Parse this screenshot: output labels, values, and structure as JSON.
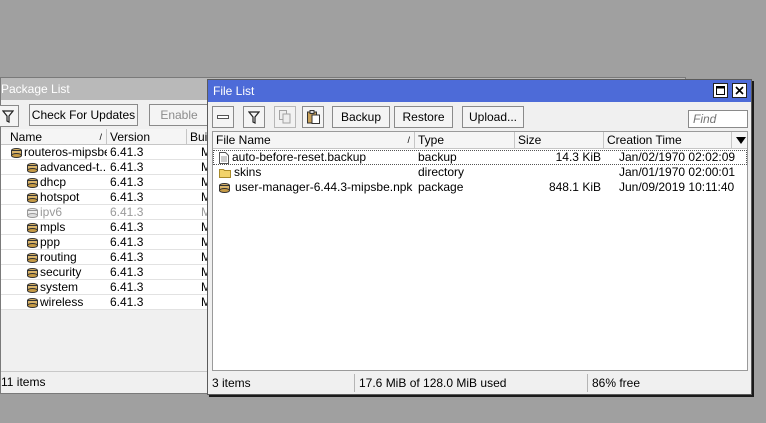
{
  "package_window": {
    "title": "Package List",
    "toolbar": {
      "check_updates": "Check For Updates",
      "enable": "Enable"
    },
    "columns": [
      "Name",
      "Version",
      "Build"
    ],
    "rows": [
      {
        "name": "routeros-mipsbe",
        "version": "6.41.3",
        "build": "M",
        "muted": false
      },
      {
        "name": "advanced-t...",
        "version": "6.41.3",
        "build": "M",
        "muted": false
      },
      {
        "name": "dhcp",
        "version": "6.41.3",
        "build": "M",
        "muted": false
      },
      {
        "name": "hotspot",
        "version": "6.41.3",
        "build": "M",
        "muted": false
      },
      {
        "name": "ipv6",
        "version": "6.41.3",
        "build": "M",
        "muted": true
      },
      {
        "name": "mpls",
        "version": "6.41.3",
        "build": "M",
        "muted": false
      },
      {
        "name": "ppp",
        "version": "6.41.3",
        "build": "M",
        "muted": false
      },
      {
        "name": "routing",
        "version": "6.41.3",
        "build": "M",
        "muted": false
      },
      {
        "name": "security",
        "version": "6.41.3",
        "build": "M",
        "muted": false
      },
      {
        "name": "system",
        "version": "6.41.3",
        "build": "M",
        "muted": false
      },
      {
        "name": "wireless",
        "version": "6.41.3",
        "build": "M",
        "muted": false
      }
    ],
    "status": "11 items"
  },
  "file_window": {
    "title": "File List",
    "toolbar": {
      "backup": "Backup",
      "restore": "Restore",
      "upload": "Upload...",
      "find_placeholder": "Find"
    },
    "columns": {
      "name": "File Name",
      "type": "Type",
      "size": "Size",
      "created": "Creation Time"
    },
    "rows": [
      {
        "name": "auto-before-reset.backup",
        "type": "backup",
        "size": "14.3 KiB",
        "created": "Jan/02/1970 02:02:09",
        "icon": "file-icon"
      },
      {
        "name": "skins",
        "type": "directory",
        "size": "",
        "created": "Jan/01/1970 02:00:01",
        "icon": "folder-icon"
      },
      {
        "name": "user-manager-6.44.3-mipsbe.npk",
        "type": "package",
        "size": "848.1 KiB",
        "created": "Jun/09/2019 10:11:40",
        "icon": "package-icon"
      }
    ],
    "status": {
      "items": "3 items",
      "usage": "17.6 MiB of 128.0 MiB used",
      "free": "86% free"
    }
  },
  "colors": {
    "active_title": "#4d6bd8",
    "inactive_title": "#b9b9b9",
    "desktop": "#a0a0a0"
  }
}
